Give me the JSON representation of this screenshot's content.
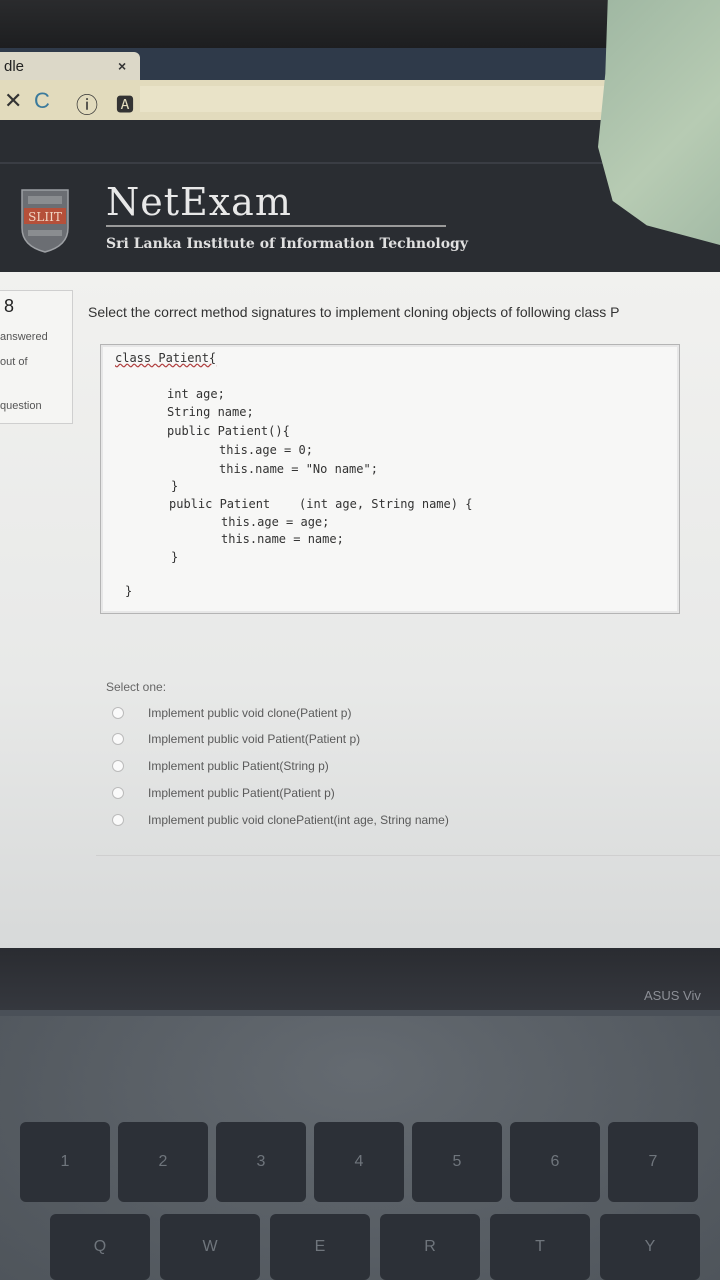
{
  "browser": {
    "tab_title": "dle",
    "tab_close": "×",
    "nav_stop": "✕",
    "nav_reload": "C",
    "nav_info": "ⓘ",
    "nav_page": "🅰"
  },
  "header": {
    "brand": "NetExam",
    "subtitle": "Sri Lanka Institute of Information Technology",
    "logo_text": "SLIIT"
  },
  "question_info": {
    "number": "8",
    "state": "answered",
    "marks": "out of",
    "flag": "question"
  },
  "question": {
    "text": "Select the correct method signatures to implement cloning objects of following class P",
    "code": [
      "class Patient{",
      "int age;",
      "String name;",
      "public Patient(){",
      "this.age = 0;",
      "this.name = \"No name\";",
      "}",
      "public Patient    (int age, String name) {",
      "this.age = age;",
      "this.name = name;",
      "}",
      "}"
    ]
  },
  "answer": {
    "select_label": "Select one:",
    "options": [
      "Implement public void clone(Patient p)",
      "Implement public void Patient(Patient p)",
      "Implement public Patient(String p)",
      "Implement public Patient(Patient p)",
      "Implement public void clonePatient(int age, String name)"
    ]
  },
  "laptop": {
    "brand": "ASUS Viv",
    "keys_row1": [
      "1",
      "2",
      "3",
      "4",
      "5",
      "6",
      "7"
    ],
    "keys_row2": [
      "Q",
      "W",
      "E",
      "R",
      "T",
      "Y"
    ]
  }
}
